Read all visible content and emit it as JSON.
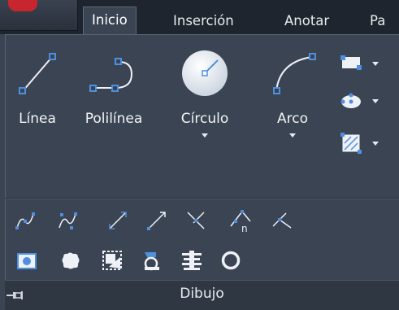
{
  "tabs": [
    {
      "label": "Inicio",
      "active": true
    },
    {
      "label": "Inserción",
      "active": false
    },
    {
      "label": "Anotar",
      "active": false
    },
    {
      "label": "Pa",
      "active": false
    }
  ],
  "tools": {
    "linea": "Línea",
    "polilinea": "Polilínea",
    "circulo": "Círculo",
    "arco": "Arco"
  },
  "panel_title": "Dibujo",
  "colors": {
    "background": "#3b4453",
    "tabbar": "#1f252e",
    "icon_blue": "#4f8fe0",
    "icon_white": "#eef1f5",
    "app_red": "#c8262e"
  },
  "icons": {
    "small_tools": [
      "rectangle-icon",
      "ellipse-icon",
      "hatch-icon"
    ],
    "row1": [
      "spline-fit-icon",
      "spline-cv-icon",
      "construction-line-icon",
      "ray-icon",
      "multiple-points-icon",
      "divide-icon",
      "xline-icon"
    ],
    "row2": [
      "region-icon",
      "revision-cloud-icon",
      "wipeout-icon",
      "boundary-icon",
      "table-icon",
      "donut-icon"
    ]
  }
}
